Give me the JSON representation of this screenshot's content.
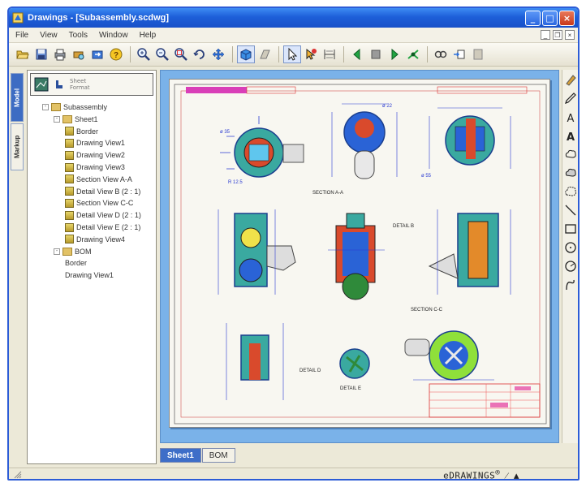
{
  "window": {
    "title": "Drawings - [Subassembly.scdwg]",
    "icons": {
      "app": "drawing-app-icon",
      "minimize": "minimize-icon",
      "maximize": "maximize-icon",
      "close": "close-icon"
    }
  },
  "menubar": {
    "items": [
      {
        "label": "File"
      },
      {
        "label": "View"
      },
      {
        "label": "Tools"
      },
      {
        "label": "Window"
      },
      {
        "label": "Help"
      }
    ]
  },
  "toolbar": {
    "groups": [
      [
        "open-icon",
        "save-icon",
        "print-icon",
        "print-preview-icon",
        "export-icon",
        "help-icon"
      ],
      [
        "zoom-in-icon",
        "zoom-out-icon",
        "zoom-window-icon",
        "rotate-icon",
        "pan-icon"
      ],
      [
        "shaded-icon",
        "wireframe-icon"
      ],
      [
        "select-icon",
        "smart-select-icon",
        "dimension-icon"
      ],
      [
        "previous-icon",
        "stop-icon",
        "next-icon",
        "expand-icon"
      ],
      [
        "link-icon",
        "update-icon",
        "sheet-icon"
      ]
    ]
  },
  "side_tabs": [
    {
      "label": "Model"
    },
    {
      "label": "Markup"
    }
  ],
  "tree": {
    "header_text": [
      "Sheet",
      "Format"
    ],
    "rows": [
      {
        "label": "Subassembly",
        "indent": 0,
        "type": "folder",
        "expander": "-"
      },
      {
        "label": "Sheet1",
        "indent": 1,
        "type": "folder",
        "expander": "-"
      },
      {
        "label": "Border",
        "indent": 2,
        "type": "node"
      },
      {
        "label": "Drawing View1",
        "indent": 2,
        "type": "node"
      },
      {
        "label": "Drawing View2",
        "indent": 2,
        "type": "node"
      },
      {
        "label": "Drawing View3",
        "indent": 2,
        "type": "node"
      },
      {
        "label": "Section View A-A",
        "indent": 2,
        "type": "node"
      },
      {
        "label": "Detail View B (2 : 1)",
        "indent": 2,
        "type": "node"
      },
      {
        "label": "Section View C-C",
        "indent": 2,
        "type": "node"
      },
      {
        "label": "Detail View D (2 : 1)",
        "indent": 2,
        "type": "node"
      },
      {
        "label": "Detail View E (2 : 1)",
        "indent": 2,
        "type": "node"
      },
      {
        "label": "Drawing View4",
        "indent": 2,
        "type": "node"
      },
      {
        "label": "BOM",
        "indent": 1,
        "type": "folder",
        "expander": "-"
      },
      {
        "label": "Border",
        "indent": 2,
        "type": "plain"
      },
      {
        "label": "Drawing View1",
        "indent": 2,
        "type": "plain"
      }
    ]
  },
  "drawing": {
    "labels": {
      "section_aa": "SECTION A-A",
      "detail_b": "DETAIL B",
      "section_cc": "SECTION C-C",
      "detail_d": "DETAIL D",
      "detail_e": "DETAIL E"
    }
  },
  "right_tools": [
    "markup-icon",
    "pencil-icon",
    "text-icon",
    "text-bold-icon",
    "cloud-icon",
    "cloud-fill-icon",
    "cloud-outline-icon",
    "line-icon",
    "rectangle-icon",
    "circle-icon",
    "ellipse-icon",
    "curve-icon"
  ],
  "sheet_tabs": [
    {
      "label": "Sheet1",
      "active": true
    },
    {
      "label": "BOM",
      "active": false
    }
  ],
  "statusbar": {
    "brand": "eDRAWINGS",
    "brand_mark": "®",
    "grip_icon": "resize-grip-icon"
  },
  "colors": {
    "titlebar": "#1d5fd9",
    "canvas_bg": "#7ab2e9",
    "dimension_blue": "#2b3bd1",
    "part_teal": "#3aa9a0",
    "active_tab": "#3e6ec8"
  }
}
